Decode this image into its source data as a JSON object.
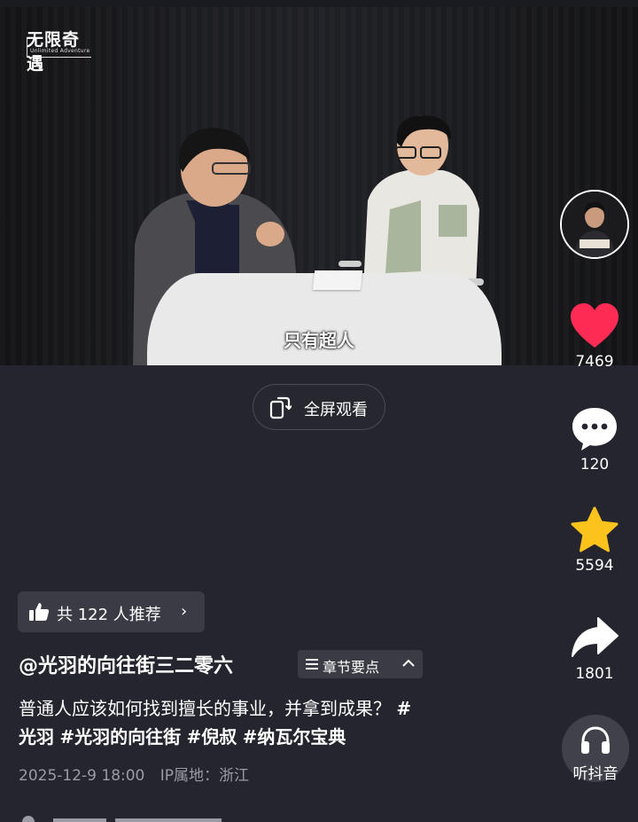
{
  "video": {
    "channel_logo": "无限奇遇",
    "channel_logo_sub": "Unlimited Adventure",
    "subtitle": "只有超人",
    "fullscreen_label": "全屏观看"
  },
  "rail": {
    "likes": "7469",
    "comments": "120",
    "favorites": "5594",
    "shares": "1801",
    "listen_label": "听抖音"
  },
  "recommend": {
    "text": "共 122 人推荐",
    "arrow": "›"
  },
  "post": {
    "author": "@光羽的向往街三二零六",
    "chapter_label": "章节要点",
    "chapter_arrow": "^",
    "description_main": "普通人应该如何找到擅长的事业，并拿到成果？",
    "hashtags": [
      "#",
      "光羽",
      "#光羽的向往街",
      "#倪叔",
      "#纳瓦尔宝典"
    ],
    "date": "2025-12-9 18:00",
    "ip_location": "IP属地：浙江"
  },
  "colors": {
    "background": "#24252e",
    "like": "#fe2c55",
    "favorite": "#fcc31d",
    "chip": "#3a3b44"
  },
  "icons": [
    "like-heart-icon",
    "comment-icon",
    "favorite-star-icon",
    "share-arrow-icon",
    "headphones-icon",
    "thumbs-up-icon",
    "fullscreen-icon",
    "list-icon"
  ]
}
